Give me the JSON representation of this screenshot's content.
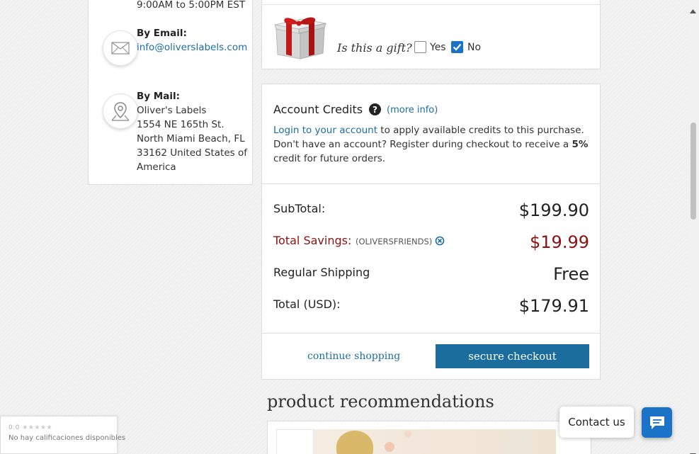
{
  "contact": {
    "hours_text": "9:00AM to 5:00PM EST",
    "email_label": "By Email:",
    "email_value": "info@oliverslabels.com",
    "mail_label": "By Mail:",
    "mail_lines": [
      "Oliver's Labels",
      "1554 NE 165th St.",
      "North Miami Beach, FL",
      "33162 United States of",
      "America"
    ]
  },
  "gift": {
    "question": "Is this a gift?",
    "yes_label": "Yes",
    "no_label": "No",
    "yes_checked": false,
    "no_checked": true
  },
  "credits": {
    "title": "Account Credits",
    "more_info": "(more info)",
    "login_link": "Login to your account",
    "line1_rest": " to apply available credits to this purchase.",
    "line2_start": "Don't have an account? Register during checkout to receive a ",
    "line2_bold": "5%",
    "line3": "credit for future orders."
  },
  "totals": {
    "subtotal_label": "SubTotal:",
    "subtotal_value": "$199.90",
    "savings_label": "Total Savings:",
    "savings_code": "(OLIVERSFRIENDS)",
    "savings_value": "$19.99",
    "shipping_label": "Regular Shipping",
    "shipping_value": "Free",
    "total_label": "Total (USD):",
    "total_value": "$179.91"
  },
  "actions": {
    "continue_shopping": "continue shopping",
    "secure_checkout": "secure checkout"
  },
  "recommendations": {
    "title": "product recommendations"
  },
  "chat": {
    "contact_us": "Contact us"
  },
  "rating_widget": {
    "score": "0.0",
    "stars": "★★★★★",
    "text": "No hay calificaciones disponibles"
  },
  "colors": {
    "accent_blue": "#1a6d9c",
    "savings_red": "#8b1111",
    "link_blue": "#1b6ea3"
  },
  "icons": [
    "envelope-icon",
    "map-pin-icon",
    "gift-box-icon",
    "help-icon",
    "remove-coupon-icon",
    "chat-bubble-icon"
  ]
}
